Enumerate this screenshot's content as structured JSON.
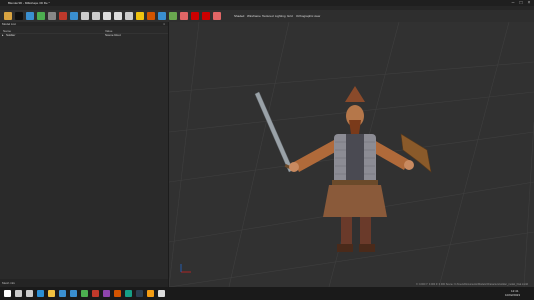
{
  "window": {
    "title": "Blender3D - Milkshape 3D file *"
  },
  "menu": [
    "File",
    "Edit",
    "Window",
    "Tools",
    "Help"
  ],
  "toolbar": {
    "buttons": [
      {
        "name": "open-folder-icon",
        "color": "#d9a441"
      },
      {
        "name": "save-icon",
        "color": "#111111"
      },
      {
        "name": "camera-icon",
        "color": "#3a8fd0"
      },
      {
        "name": "image-icon",
        "color": "#4caf50"
      },
      {
        "name": "grid-icon",
        "color": "#888888"
      },
      {
        "name": "cube-icon",
        "color": "#c0392b"
      },
      {
        "name": "globe-icon",
        "color": "#3a8fd0"
      },
      {
        "name": "move-icon",
        "color": "#cccccc"
      },
      {
        "name": "pointer-icon",
        "color": "#cccccc"
      },
      {
        "name": "eye-icon",
        "color": "#dddddd"
      },
      {
        "name": "palette-icon",
        "color": "#dddddd"
      },
      {
        "name": "texture-icon",
        "color": "#cccccc"
      },
      {
        "name": "bulb-icon",
        "color": "#f1c40f"
      },
      {
        "name": "magic-icon",
        "color": "#d35400"
      },
      {
        "name": "select-icon",
        "color": "#3a8fd0"
      },
      {
        "name": "shading-icon",
        "color": "#6aa84f"
      },
      {
        "name": "wire-icon",
        "color": "#e06666"
      },
      {
        "name": "stop-icon",
        "color": "#cc0000"
      },
      {
        "name": "record-icon",
        "color": "#cc0000"
      },
      {
        "name": "sun-icon",
        "color": "#e06666"
      }
    ],
    "labels": [
      "Shaded",
      "Wireframe",
      "Textured",
      "Lighting",
      "Grid",
      "Orthographic view"
    ]
  },
  "left_panel": {
    "title": "Model List",
    "close": "×",
    "columns": [
      "Name",
      "Value"
    ],
    "rows": [
      {
        "name": "Soldier",
        "value": "Scene Root"
      }
    ],
    "status": "Mesh info"
  },
  "viewport": {
    "status": "X: 0.000  Y: 0.000  Z: 0.000   Scene: C:/Users/Documents/Models/Characters/soldier_model_final.ms3d"
  },
  "taskbar": {
    "time": "12:41",
    "date": "10/02/2023",
    "icons": [
      {
        "name": "start-icon",
        "color": "#ffffff"
      },
      {
        "name": "search-icon",
        "color": "#cccccc"
      },
      {
        "name": "task-view-icon",
        "color": "#cccccc"
      },
      {
        "name": "edge-icon",
        "color": "#2a8fd6"
      },
      {
        "name": "file-explorer-icon",
        "color": "#f0c040"
      },
      {
        "name": "store-icon",
        "color": "#3a8fd0"
      },
      {
        "name": "mail-icon",
        "color": "#3a8fd0"
      },
      {
        "name": "chrome-icon",
        "color": "#4caf50"
      },
      {
        "name": "app-icon-1",
        "color": "#c0392b"
      },
      {
        "name": "app-icon-2",
        "color": "#8e44ad"
      },
      {
        "name": "app-icon-3",
        "color": "#d35400"
      },
      {
        "name": "app-icon-4",
        "color": "#16a085"
      },
      {
        "name": "app-icon-5",
        "color": "#2c3e50"
      },
      {
        "name": "app-icon-6",
        "color": "#f39c12"
      },
      {
        "name": "active-app-icon",
        "color": "#dddddd"
      }
    ]
  }
}
